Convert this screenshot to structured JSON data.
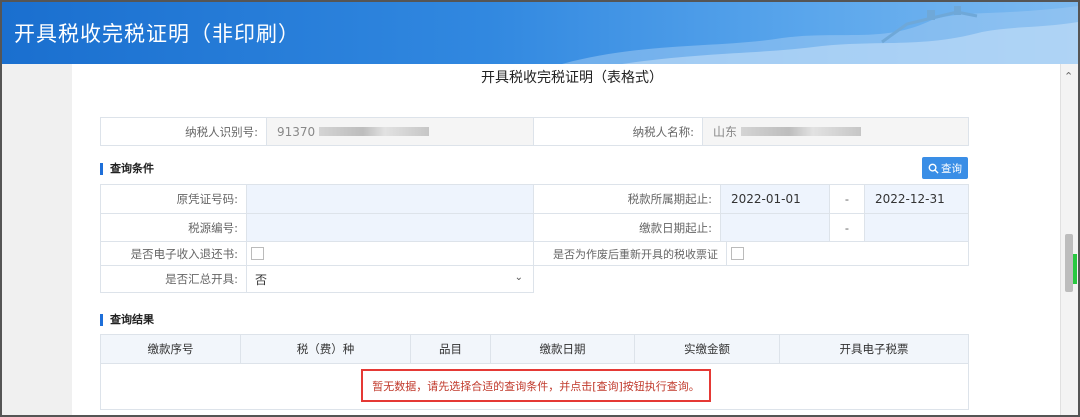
{
  "window": {
    "title": "开具税收完税证明（非印刷）"
  },
  "form": {
    "title": "开具税收完税证明（表格式）"
  },
  "taxpayer": {
    "id_label": "纳税人识别号:",
    "id_value": "91370",
    "name_label": "纳税人名称:",
    "name_value": "山东"
  },
  "query": {
    "section_title": "查询条件",
    "button_label": "查询",
    "orig_cert_label": "原凭证号码:",
    "tax_period_label": "税款所属期起止:",
    "tax_period_start": "2022-01-01",
    "tax_period_sep": "-",
    "tax_period_end": "2022-12-31",
    "tax_source_label": "税源编号:",
    "pay_date_label": "缴款日期起止:",
    "pay_date_sep": "-",
    "e_refund_label": "是否电子收入退还书:",
    "reissue_label": "是否为作废后重新开具的税收票证",
    "summary_label": "是否汇总开具:",
    "summary_value": "否"
  },
  "results": {
    "section_title": "查询结果",
    "columns": [
      "缴款序号",
      "税（费）种",
      "品目",
      "缴款日期",
      "实缴金额",
      "开具电子税票"
    ],
    "empty_message": "暂无数据，请先选择合适的查询条件，并点击[查询]按钮执行查询。"
  },
  "icons": {
    "search": "search-icon",
    "scroll_up": "chevron-up-icon",
    "select": "chevron-down-icon"
  },
  "colors": {
    "header": "#2a7fd9",
    "accent": "#1e6fd9",
    "highlight": "#e53935"
  }
}
